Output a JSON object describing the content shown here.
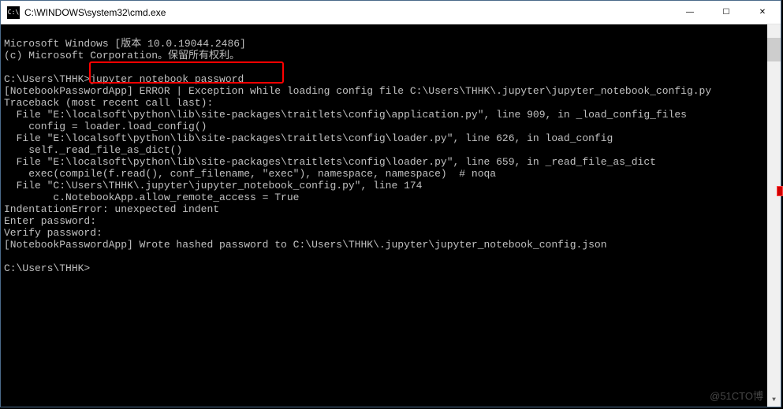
{
  "titlebar": {
    "icon_label": "C:\\",
    "title": "C:\\WINDOWS\\system32\\cmd.exe"
  },
  "controls": {
    "minimize": "—",
    "maximize": "☐",
    "close": "✕"
  },
  "console": {
    "l1": "Microsoft Windows [版本 10.0.19044.2486]",
    "l2": "(c) Microsoft Corporation。保留所有权利。",
    "l3": "",
    "l4": "C:\\Users\\THHK>jupyter notebook password",
    "l5": "[NotebookPasswordApp] ERROR | Exception while loading config file C:\\Users\\THHK\\.jupyter\\jupyter_notebook_config.py",
    "l6": "Traceback (most recent call last):",
    "l7": "  File \"E:\\localsoft\\python\\lib\\site-packages\\traitlets\\config\\application.py\", line 909, in _load_config_files",
    "l8": "    config = loader.load_config()",
    "l9": "  File \"E:\\localsoft\\python\\lib\\site-packages\\traitlets\\config\\loader.py\", line 626, in load_config",
    "l10": "    self._read_file_as_dict()",
    "l11": "  File \"E:\\localsoft\\python\\lib\\site-packages\\traitlets\\config\\loader.py\", line 659, in _read_file_as_dict",
    "l12": "    exec(compile(f.read(), conf_filename, \"exec\"), namespace, namespace)  # noqa",
    "l13": "  File \"C:\\Users\\THHK\\.jupyter\\jupyter_notebook_config.py\", line 174",
    "l14": "        c.NotebookApp.allow_remote_access = True",
    "l15": "IndentationError: unexpected indent",
    "l16": "Enter password:",
    "l17": "Verify password:",
    "l18": "[NotebookPasswordApp] Wrote hashed password to C:\\Users\\THHK\\.jupyter\\jupyter_notebook_config.json",
    "l19": "",
    "l20": "C:\\Users\\THHK>"
  },
  "watermark": "@51CTO博"
}
